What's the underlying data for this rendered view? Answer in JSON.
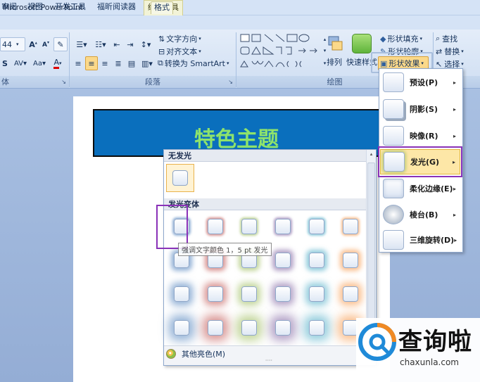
{
  "window": {
    "app_title": "Microsoft PowerPoint",
    "context_tab_group": "绘图工具"
  },
  "tabs": [
    {
      "label": "审阅"
    },
    {
      "label": "视图"
    },
    {
      "label": "开发工具"
    },
    {
      "label": "福昕阅读器"
    },
    {
      "label": "格式"
    }
  ],
  "ribbon": {
    "font": {
      "size": "44",
      "group_label": "体"
    },
    "paragraph": {
      "group_label": "段落",
      "text_direction": "文字方向",
      "align_text": "对齐文本",
      "convert_smartart": "转换为 SmartArt"
    },
    "drawing": {
      "group_label": "绘图",
      "arrange": "排列",
      "quick_styles": "快速样式",
      "shape_fill": "形状填充",
      "shape_outline": "形状轮廓",
      "shape_effects": "形状效果"
    },
    "editing": {
      "find": "查找",
      "replace": "替换",
      "select": "选择"
    }
  },
  "slide": {
    "title_text": "特色主题"
  },
  "glow_gallery": {
    "no_glow_header": "无发光",
    "variants_header": "发光变体",
    "tooltip": "强调文字颜色 1，5 pt 发光",
    "more_colors": "其他亮色(M)",
    "colors": [
      "#4f81bd",
      "#c0504d",
      "#9bbb59",
      "#8064a2",
      "#4bacc6",
      "#f79646"
    ],
    "row_sizes": [
      "5pt",
      "8pt",
      "11pt",
      "18pt"
    ]
  },
  "effects_menu": {
    "items": [
      {
        "label": "预设(P)",
        "icon": "preset-icon"
      },
      {
        "label": "阴影(S)",
        "icon": "shadow-icon"
      },
      {
        "label": "映像(R)",
        "icon": "reflection-icon"
      },
      {
        "label": "发光(G)",
        "icon": "glow-icon"
      },
      {
        "label": "柔化边缘(E)",
        "icon": "soft-edges-icon"
      },
      {
        "label": "棱台(B)",
        "icon": "bevel-icon"
      },
      {
        "label": "三维旋转(D)",
        "icon": "3d-rotation-icon"
      }
    ]
  },
  "watermark": {
    "name": "查询啦",
    "url": "chaxunla.com"
  },
  "colors": {
    "accent_highlight": "#8a32b8",
    "slide_title_fill": "#0a6fbd",
    "slide_title_text": "#8ee36b"
  }
}
